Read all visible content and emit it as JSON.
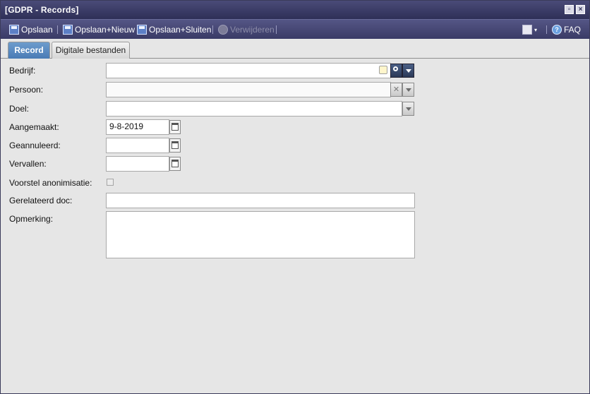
{
  "window": {
    "title": "[GDPR - Records]"
  },
  "toolbar": {
    "save_label": "Opslaan",
    "save_new_label": "Opslaan+Nieuw",
    "save_close_label": "Opslaan+Sluiten",
    "delete_label": "Verwijderen",
    "faq_label": "FAQ"
  },
  "tabs": [
    {
      "label": "Record",
      "active": true
    },
    {
      "label": "Digitale bestanden",
      "active": false
    }
  ],
  "form": {
    "bedrijf": {
      "label": "Bedrijf:",
      "value": ""
    },
    "persoon": {
      "label": "Persoon:",
      "value": ""
    },
    "doel": {
      "label": "Doel:",
      "value": ""
    },
    "aangemaakt": {
      "label": "Aangemaakt:",
      "value": "9-8-2019"
    },
    "geannuleerd": {
      "label": "Geannuleerd:",
      "value": ""
    },
    "vervallen": {
      "label": "Vervallen:",
      "value": ""
    },
    "voorstel": {
      "label": "Voorstel anonimisatie:",
      "checked": false
    },
    "gerelateerd": {
      "label": "Gerelateerd doc:",
      "value": ""
    },
    "opmerking": {
      "label": "Opmerking:",
      "value": ""
    }
  },
  "colors": {
    "titlebar": "#2e2f57",
    "toolbar": "#3a3b66",
    "active_tab": "#4a7bb5",
    "background": "#e6e6e6"
  }
}
